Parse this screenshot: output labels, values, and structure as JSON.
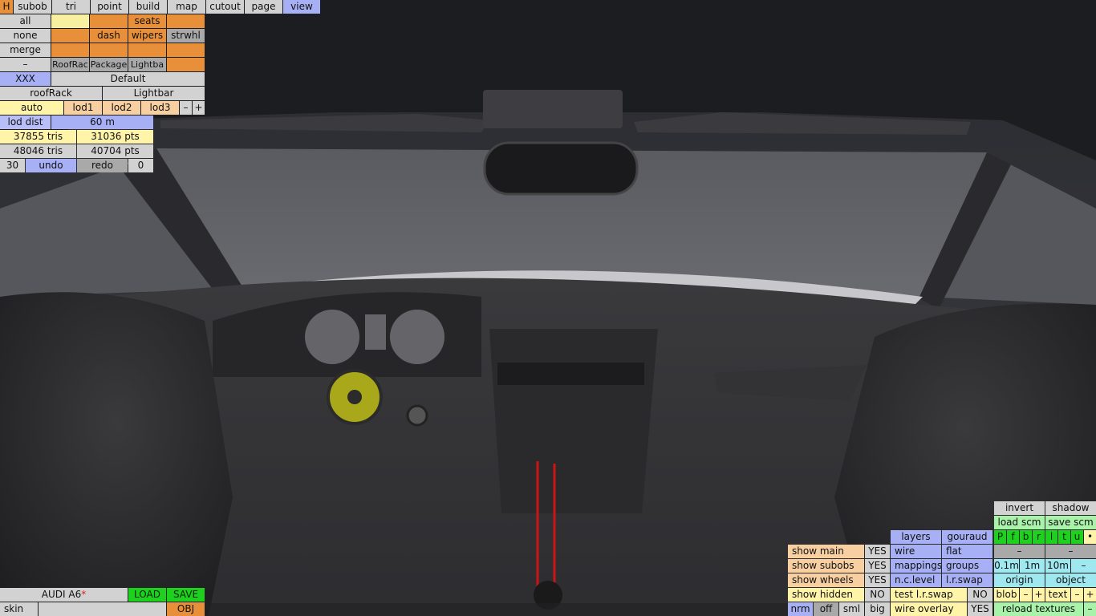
{
  "top_menu": {
    "h": "H",
    "items": [
      "subob",
      "tri",
      "point",
      "build",
      "map",
      "cutout",
      "page",
      "view"
    ]
  },
  "select": {
    "all": "all",
    "none": "none",
    "merge": "merge",
    "minus": "–",
    "seats": "seats",
    "dash": "dash",
    "wipers": "wipers",
    "strwhl": "strwhl",
    "roofrac": "RoofRac",
    "package": "Package",
    "lightba": "Lightba"
  },
  "variant": {
    "name": "XXX",
    "value": "Default",
    "roofrack": "roofRack",
    "lightbar": "Lightbar"
  },
  "lod": {
    "auto": "auto",
    "lod1": "lod1",
    "lod2": "lod2",
    "lod3": "lod3",
    "minus": "–",
    "plus": "+",
    "dist_label": "lod dist",
    "dist_value": "60 m"
  },
  "stats": {
    "tris1": "37855 tris",
    "pts1": "31036 pts",
    "tris2": "48046 tris",
    "pts2": "40704 pts"
  },
  "history": {
    "count": "30",
    "undo": "undo",
    "redo": "redo",
    "redo_count": "0"
  },
  "file": {
    "name": "AUDI A6",
    "modified_mark": "*",
    "load": "LOAD",
    "save": "SAVE",
    "skin": "skin",
    "obj": "OBJ"
  },
  "view_options": {
    "invert": "invert",
    "shadow": "shadow",
    "load_scm": "load scm",
    "save_scm": "save scm",
    "flags": [
      "P",
      "f",
      "b",
      "r",
      "l",
      "t",
      "u",
      "•"
    ],
    "layers": "layers",
    "gouraud": "gouraud",
    "wire": "wire",
    "flat": "flat",
    "mappings": "mappings",
    "groups": "groups",
    "nclevel": "n.c.level",
    "lrswap": "l.r.swap",
    "test_lrswap": "test l.r.swap",
    "test_lrswap_val": "NO",
    "wire_overlay": "wire overlay",
    "wire_overlay_val": "YES",
    "dash": "–",
    "step1": "0.1m",
    "step2": "1m",
    "step3": "10m",
    "step_minus": "–",
    "origin": "origin",
    "object": "object",
    "blob": "blob",
    "text": "text",
    "minus": "–",
    "plus": "+",
    "reload": "reload textures"
  },
  "show": {
    "main": "show main",
    "main_val": "YES",
    "subobs": "show subobs",
    "subobs_val": "YES",
    "wheels": "show wheels",
    "wheels_val": "YES",
    "hidden": "show hidden",
    "hidden_val": "NO"
  },
  "normals": {
    "nrm": "nrm",
    "off": "off",
    "sml": "sml",
    "big": "big"
  },
  "colors": {
    "orange": "#e88f3a",
    "yellow": "#f6f0a0",
    "blue": "#a7b0f5",
    "green": "#1fd11f",
    "grey": "#d2d2d2",
    "background": "#2b2c30"
  }
}
